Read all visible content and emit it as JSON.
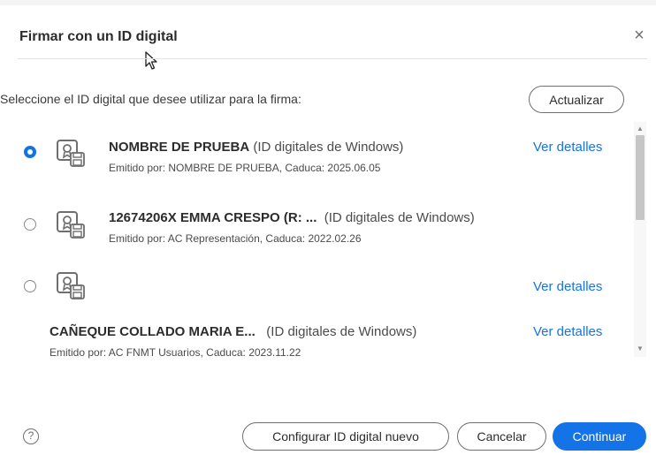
{
  "dialog": {
    "title": "Firmar con un ID digital",
    "close_glyph": "×",
    "instruction": "Seleccione el ID digital que desee utilizar para la firma:",
    "refresh_label": "Actualizar"
  },
  "certificates": [
    {
      "name": "NOMBRE DE PRUEBA",
      "source": "(ID digitales de Windows)",
      "issued": "Emitido por: NOMBRE DE PRUEBA, Caduca: 2025.06.05",
      "details": "Ver detalles",
      "selected": true
    },
    {
      "name": "12674206X EMMA CRESPO (R: ...",
      "source": "(ID digitales de Windows)",
      "issued": "Emitido por: AC Representación, Caduca: 2022.02.26",
      "details": "",
      "selected": false
    },
    {
      "name": "",
      "source": "",
      "issued": "",
      "details": "Ver detalles",
      "selected": false
    },
    {
      "name": "CAÑEQUE COLLADO MARIA E...",
      "source": "(ID digitales de Windows)",
      "issued": "Emitido por: AC FNMT Usuarios, Caduca: 2023.11.22",
      "details": "Ver detalles",
      "selected": false
    }
  ],
  "scrollbar": {
    "up_glyph": "▲",
    "down_glyph": "▼"
  },
  "footer": {
    "help_glyph": "?",
    "configure_label": "Configurar ID digital nuevo",
    "cancel_label": "Cancelar",
    "continue_label": "Continuar"
  },
  "colors": {
    "accent": "#1473e6",
    "text": "#2c2c2c",
    "border": "#6e6e6e"
  }
}
